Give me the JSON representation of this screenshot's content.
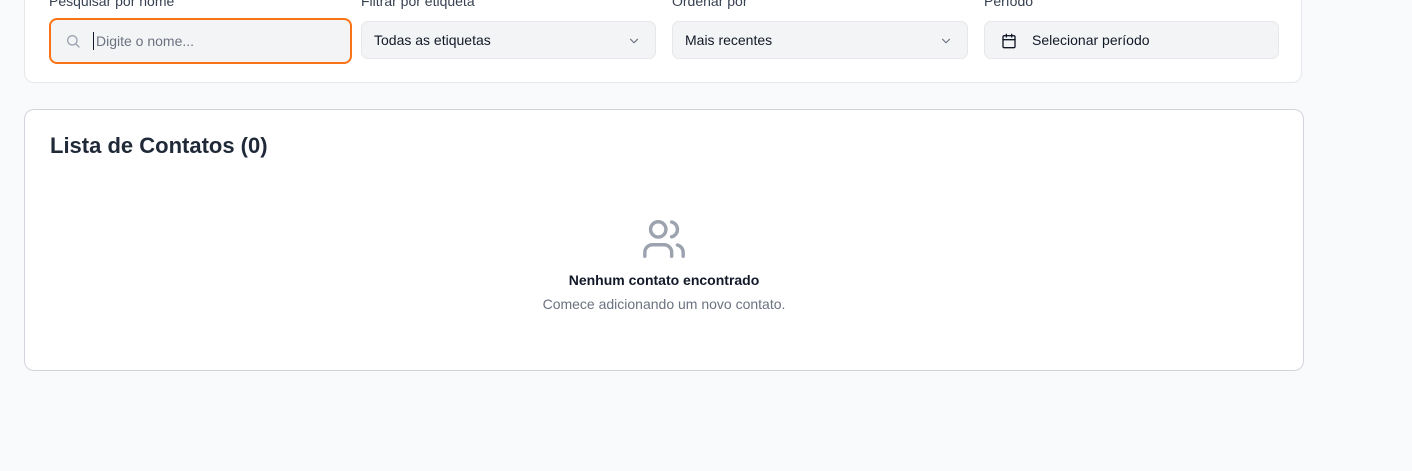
{
  "filters": {
    "search": {
      "label": "Pesquisar por nome",
      "placeholder": "Digite o nome...",
      "value": ""
    },
    "tag_filter": {
      "label": "Filtrar por etiqueta",
      "selected": "Todas as etiquetas"
    },
    "sort": {
      "label": "Ordenar por",
      "selected": "Mais recentes"
    },
    "period": {
      "label": "Período",
      "button_label": "Selecionar período"
    }
  },
  "contacts": {
    "title": "Lista de Contatos (0)",
    "empty_title": "Nenhum contato encontrado",
    "empty_subtitle": "Comece adicionando um novo contato.",
    "empty_icon": "users-icon"
  },
  "colors": {
    "accent": "#f97316",
    "background": "#f9fafb",
    "muted_text": "#6b7280"
  }
}
